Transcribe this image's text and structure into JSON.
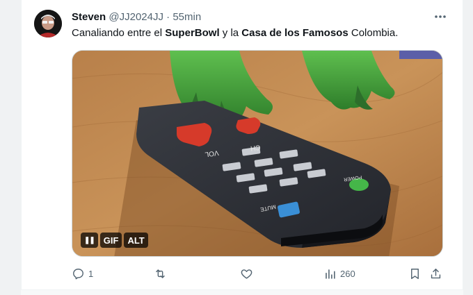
{
  "post": {
    "author_name": "Steven",
    "handle": "@JJ2024JJ",
    "separator": "·",
    "time": "55min",
    "text_parts": {
      "t1": "Canaliando entre el ",
      "t2": "SuperBowl",
      "t3": " y la ",
      "t4": "Casa de los Famosos",
      "t5": " Colombia."
    }
  },
  "media": {
    "badges": {
      "pause": "❚❚",
      "gif": "GIF",
      "alt": "ALT"
    },
    "remote_labels": {
      "ch": "CH",
      "vol": "VOL",
      "power": "POWER",
      "mute": "MUTE"
    }
  },
  "actions": {
    "reply_count": "1",
    "repost_count": "",
    "like_count": "",
    "views_count": "260"
  },
  "icons": [
    "more-icon",
    "reply-icon",
    "repost-icon",
    "like-icon",
    "views-icon",
    "bookmark-icon",
    "share-icon"
  ],
  "colors": {
    "icon_gray": "#536471",
    "text": "#0f1419",
    "remote_red": "#d63a2a",
    "remote_green": "#45b649",
    "remote_blue": "#3a8fd6"
  }
}
